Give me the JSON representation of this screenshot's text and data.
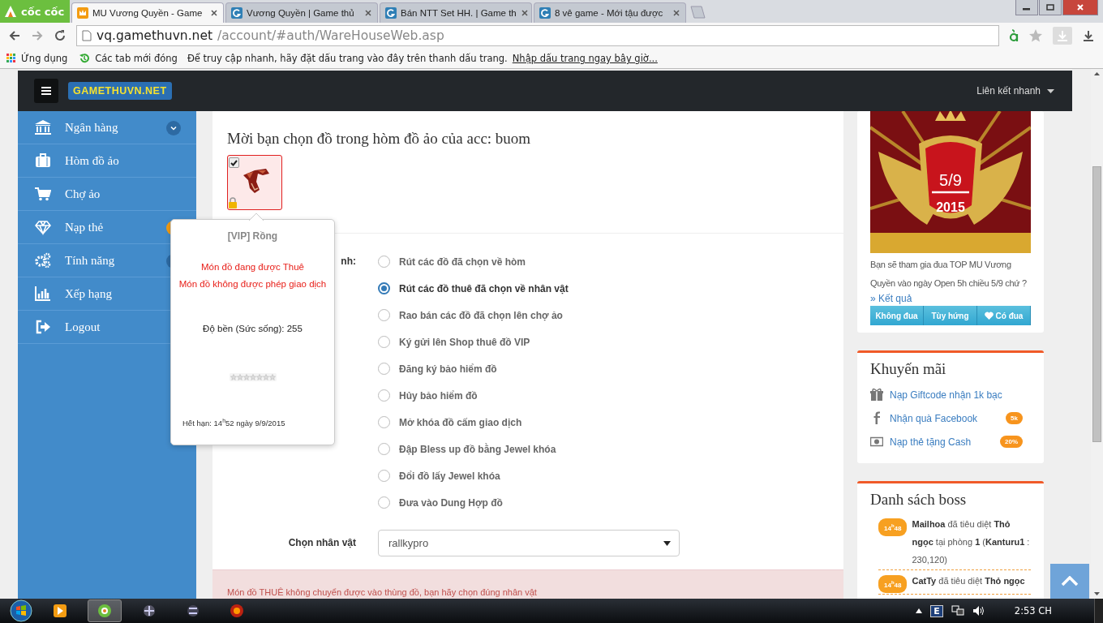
{
  "browser": {
    "brand": "cốc cốc",
    "tabs": [
      {
        "title": "MU Vương Quyền - Game",
        "selected": true
      },
      {
        "title": "Vương Quyền | Game thủ",
        "selected": false
      },
      {
        "title": "Bán NTT Set HH. | Game th",
        "selected": false
      },
      {
        "title": "8 vê game - Mới tậu được",
        "selected": false
      }
    ],
    "address": {
      "host": "vq.gamethuvn.net",
      "path": "/account/#auth/WareHouseWeb.asp"
    },
    "bookmarks": {
      "apps": "Ứng dụng",
      "recent": "Các tab mới đóng",
      "hint": "Để truy cập nhanh, hãy đặt dấu trang vào đây trên thanh dấu trang.",
      "import_link": "Nhập dấu trang ngay bây giờ..."
    }
  },
  "navbar": {
    "logo": "GAMETHUVN.NET",
    "quick_links": "Liên kết nhanh"
  },
  "sidebar": {
    "items": [
      {
        "label": "Ngân hàng"
      },
      {
        "label": "Hòm đồ ảo"
      },
      {
        "label": "Chợ ảo"
      },
      {
        "label": "Nạp thẻ"
      },
      {
        "label": "Tính năng"
      },
      {
        "label": "Xếp hạng"
      },
      {
        "label": "Logout"
      }
    ]
  },
  "warehouse": {
    "title": "Mời bạn chọn đồ trong hòm đồ ảo của acc: buom",
    "items": [
      {
        "checked": true
      }
    ],
    "action_label": "nh:",
    "actions": [
      {
        "label": "Rút các đồ đã chọn về hòm",
        "selected": false
      },
      {
        "label": "Rút các đồ thuê đã chọn về nhân vật",
        "selected": true
      },
      {
        "label": "Rao bán các đồ đã chọn lên chợ ảo",
        "selected": false
      },
      {
        "label": "Ký gửi lên Shop thuê đồ VIP",
        "selected": false
      },
      {
        "label": "Đăng ký bảo hiểm đồ",
        "selected": false
      },
      {
        "label": "Hủy bảo hiểm đồ",
        "selected": false
      },
      {
        "label": "Mở khóa đồ cấm giao dịch",
        "selected": false
      },
      {
        "label": "Đập Bless up đồ bằng Jewel khóa",
        "selected": false
      },
      {
        "label": "Đổi đồ lấy Jewel khóa",
        "selected": false
      },
      {
        "label": "Đưa vào Dung Hợp đồ",
        "selected": false
      }
    ],
    "character": {
      "label": "Chọn nhân vật",
      "value": "rallkypro"
    },
    "alert": "Món đồ THUÊ không chuyển được vào thùng đồ, bạn hãy chọn đúng nhân vật"
  },
  "popover": {
    "title": "[VIP] Rồng",
    "notes": [
      "Món đồ đang được Thuê",
      "Món đồ không được phép giao dịch"
    ],
    "durability": "Độ bền (Sức sống): 255",
    "stars": 0,
    "expiry": "Hết hạn: 14$^{h}$52 ngày 9/9/2015"
  },
  "event": {
    "banner_date": "5/9",
    "banner_year": "2015",
    "question": "Bạn sẽ tham gia đua TOP MU Vương Quyền vào ngày Open 5h chiều 5/9 chứ ?",
    "results_link": "» Kết quả",
    "votes": [
      "Không đua",
      "Tùy hứng",
      "Có đua"
    ]
  },
  "promotions": {
    "title": "Khuyến mãi",
    "items": [
      {
        "label": "Nạp Giftcode nhận 1k bạc"
      },
      {
        "label": "Nhận quà Facebook",
        "badge": "5k"
      },
      {
        "label": "Nạp thẻ tặng Cash",
        "badge": "20%"
      }
    ]
  },
  "bosses": {
    "title": "Danh sách boss",
    "entries": [
      {
        "time": "14$^{h}$48",
        "text": "**Mailhoa** đã tiêu diệt **Thỏ ngọc** tại phòng **1** (**Kanturu1** : 230,120)"
      },
      {
        "time": "14$^{h}$48",
        "text": "**CatTy** đã tiêu diệt **Thỏ ngọc**"
      }
    ]
  },
  "taskbar": {
    "language": "E",
    "clock": "2:53 CH"
  }
}
